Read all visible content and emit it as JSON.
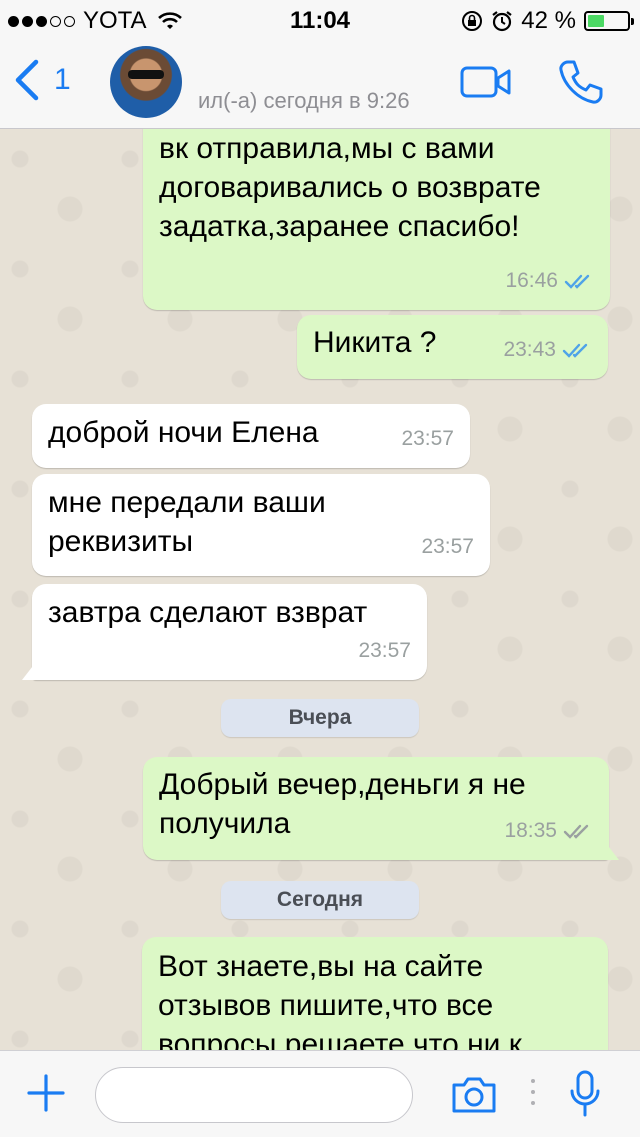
{
  "status_bar": {
    "carrier": "YOTA",
    "time": "11:04",
    "battery": "42 %",
    "battery_level": 0.42
  },
  "header": {
    "back_count": "1",
    "last_seen": "ил(-а) сегодня в 9:26"
  },
  "messages": [
    {
      "direction": "out",
      "text": "вк отправила,мы с вами договаривались о возврате задатка,заранее спасибо!",
      "time": "16:46",
      "read": true
    },
    {
      "direction": "out",
      "text": "Никита ?",
      "time": "23:43",
      "read": true
    },
    {
      "direction": "in",
      "text": "доброй ночи Елена",
      "time": "23:57"
    },
    {
      "direction": "in",
      "text": "мне передали ваши реквизиты",
      "time": "23:57"
    },
    {
      "direction": "in",
      "text": "завтра сделают взврат",
      "time": "23:57"
    },
    {
      "direction": "out",
      "text": "Добрый вечер,деньги я не получила",
      "time": "18:35",
      "read": false
    },
    {
      "direction": "out",
      "text": "Вот знаете,вы на сайте отзывов пишите,что все вопросы решаете,что ни к",
      "time": ""
    }
  ],
  "dates": [
    "Вчера",
    "Сегодня"
  ],
  "composer": {
    "placeholder": ""
  },
  "colors": {
    "accent": "#1a7cf2",
    "outgoing_bubble": "#dcf8c6",
    "incoming_bubble": "#ffffff",
    "read_ticks": "#4fa3e8",
    "unread_ticks": "#9aa0a0",
    "chat_background": "#e6e0d6"
  }
}
